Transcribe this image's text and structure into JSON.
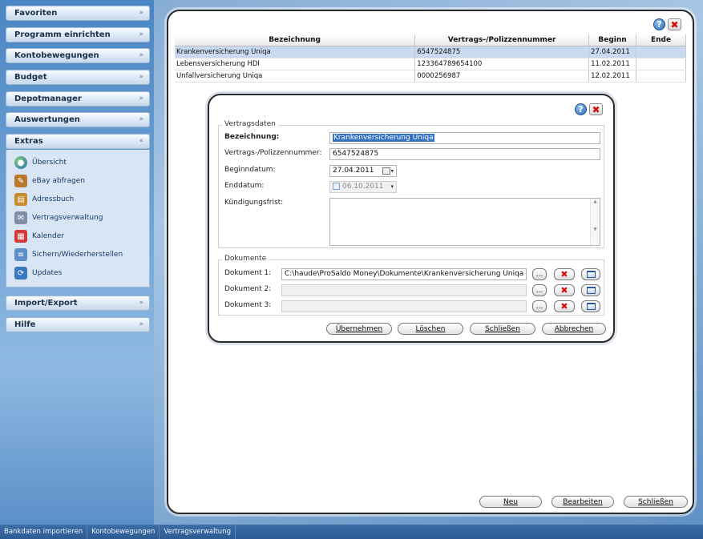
{
  "sidebar": {
    "headers": [
      {
        "label": "Favoriten",
        "chevron": "»"
      },
      {
        "label": "Programm einrichten",
        "chevron": "»"
      },
      {
        "label": "Kontobewegungen",
        "chevron": "»"
      },
      {
        "label": "Budget",
        "chevron": "»"
      },
      {
        "label": "Depotmanager",
        "chevron": "»"
      },
      {
        "label": "Auswertungen",
        "chevron": "»"
      },
      {
        "label": "Extras",
        "chevron": "«"
      },
      {
        "label": "Import/Export",
        "chevron": "»"
      },
      {
        "label": "Hilfe",
        "chevron": "»"
      }
    ],
    "extras_items": [
      {
        "label": "Übersicht",
        "icon": "globe-icon"
      },
      {
        "label": "eBay abfragen",
        "icon": "gavel-icon"
      },
      {
        "label": "Adressbuch",
        "icon": "address-book-icon"
      },
      {
        "label": "Vertragsverwaltung",
        "icon": "contract-icon"
      },
      {
        "label": "Kalender",
        "icon": "calendar-icon"
      },
      {
        "label": "Sichern/Wiederherstellen",
        "icon": "backup-icon"
      },
      {
        "label": "Updates",
        "icon": "update-icon"
      }
    ]
  },
  "grid": {
    "columns": [
      "Bezeichnung",
      "Vertrags-/Polizzennummer",
      "Beginn",
      "Ende"
    ],
    "rows": [
      {
        "name": "Krankenversicherung Uniqa",
        "number": "6547524875",
        "begin": "27.04.2011",
        "end": ""
      },
      {
        "name": "Lebensversicherung HDI",
        "number": "123364789654100",
        "begin": "11.02.2011",
        "end": ""
      },
      {
        "name": "Unfallversicherung Uniqa",
        "number": "0000256987",
        "begin": "12.02.2011",
        "end": ""
      }
    ]
  },
  "main_buttons": {
    "neu": "Neu",
    "bearbeiten": "Bearbeiten",
    "schliessen": "Schließen"
  },
  "dialog": {
    "group_vertragsdaten": "Vertragsdaten",
    "bezeichnung_label": "Bezeichnung:",
    "bezeichnung_value": "Krankenversicherung Uniqa",
    "nummer_label": "Vertrags-/Polizzennummer:",
    "nummer_value": "6547524875",
    "beginn_label": "Beginndatum:",
    "beginn_value": "27.04.2011",
    "ende_label": "Enddatum:",
    "ende_value": "06.10.2011",
    "frist_label": "Kündigungsfrist:",
    "frist_value": "",
    "group_dokumente": "Dokumente",
    "doc1_label": "Dokument 1:",
    "doc1_value": "C:\\haude\\ProSaldo Money\\Dokumente\\Krankenversicherung Uniqa",
    "doc2_label": "Dokument 2:",
    "doc2_value": "",
    "doc3_label": "Dokument 3:",
    "doc3_value": "",
    "browse_label": "...",
    "uebernehmen": "Übernehmen",
    "loeschen": "Löschen",
    "schliessen": "Schließen",
    "abbrechen": "Abbrechen"
  },
  "window_icons": {
    "help": "?",
    "close": "✖"
  },
  "statusbar": [
    "Bankdaten importieren",
    "Kontobewegungen",
    "Vertragsverwaltung"
  ]
}
